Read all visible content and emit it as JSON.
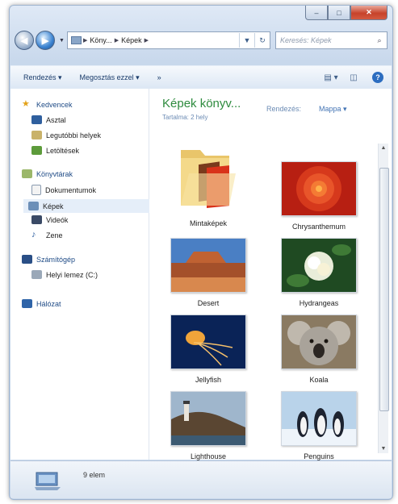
{
  "window": {
    "controls": {
      "minimize": "–",
      "maximize": "□",
      "close": "✕"
    }
  },
  "addressbar": {
    "back_icon": "back-arrow-icon",
    "forward_icon": "forward-arrow-icon",
    "crumbs": [
      "Köny...",
      "Képek"
    ],
    "refresh_icon": "refresh-icon",
    "search_placeholder": "Keresés: Képek"
  },
  "toolbar": {
    "organize": "Rendezés ▾",
    "share": "Megosztás ezzel ▾",
    "more": "»"
  },
  "sidebar": {
    "favorites": "Kedvencek",
    "fav_items": [
      "Asztal",
      "Legutóbbi helyek",
      "Letöltések"
    ],
    "libraries": "Könyvtárak",
    "lib_items": [
      "Dokumentumok",
      "Képek",
      "Videók",
      "Zene"
    ],
    "computer": "Számítógép",
    "computer_items": [
      "Helyi lemez (C:)"
    ],
    "network": "Hálózat"
  },
  "content": {
    "title": "Képek könyv...",
    "subtitle": "Tartalma: 2 hely",
    "arrange_label": "Rendezés:",
    "arrange_value": "Mappa ▾",
    "items": [
      {
        "label": "Mintaképek",
        "kind": "folder"
      },
      {
        "label": "Chrysanthemum",
        "kind": "chrysanthemum"
      },
      {
        "label": "Desert",
        "kind": "desert"
      },
      {
        "label": "Hydrangeas",
        "kind": "hydrangeas"
      },
      {
        "label": "Jellyfish",
        "kind": "jellyfish"
      },
      {
        "label": "Koala",
        "kind": "koala"
      },
      {
        "label": "Lighthouse",
        "kind": "lighthouse"
      },
      {
        "label": "Penguins",
        "kind": "penguins"
      }
    ]
  },
  "status": {
    "count": "9 elem"
  }
}
